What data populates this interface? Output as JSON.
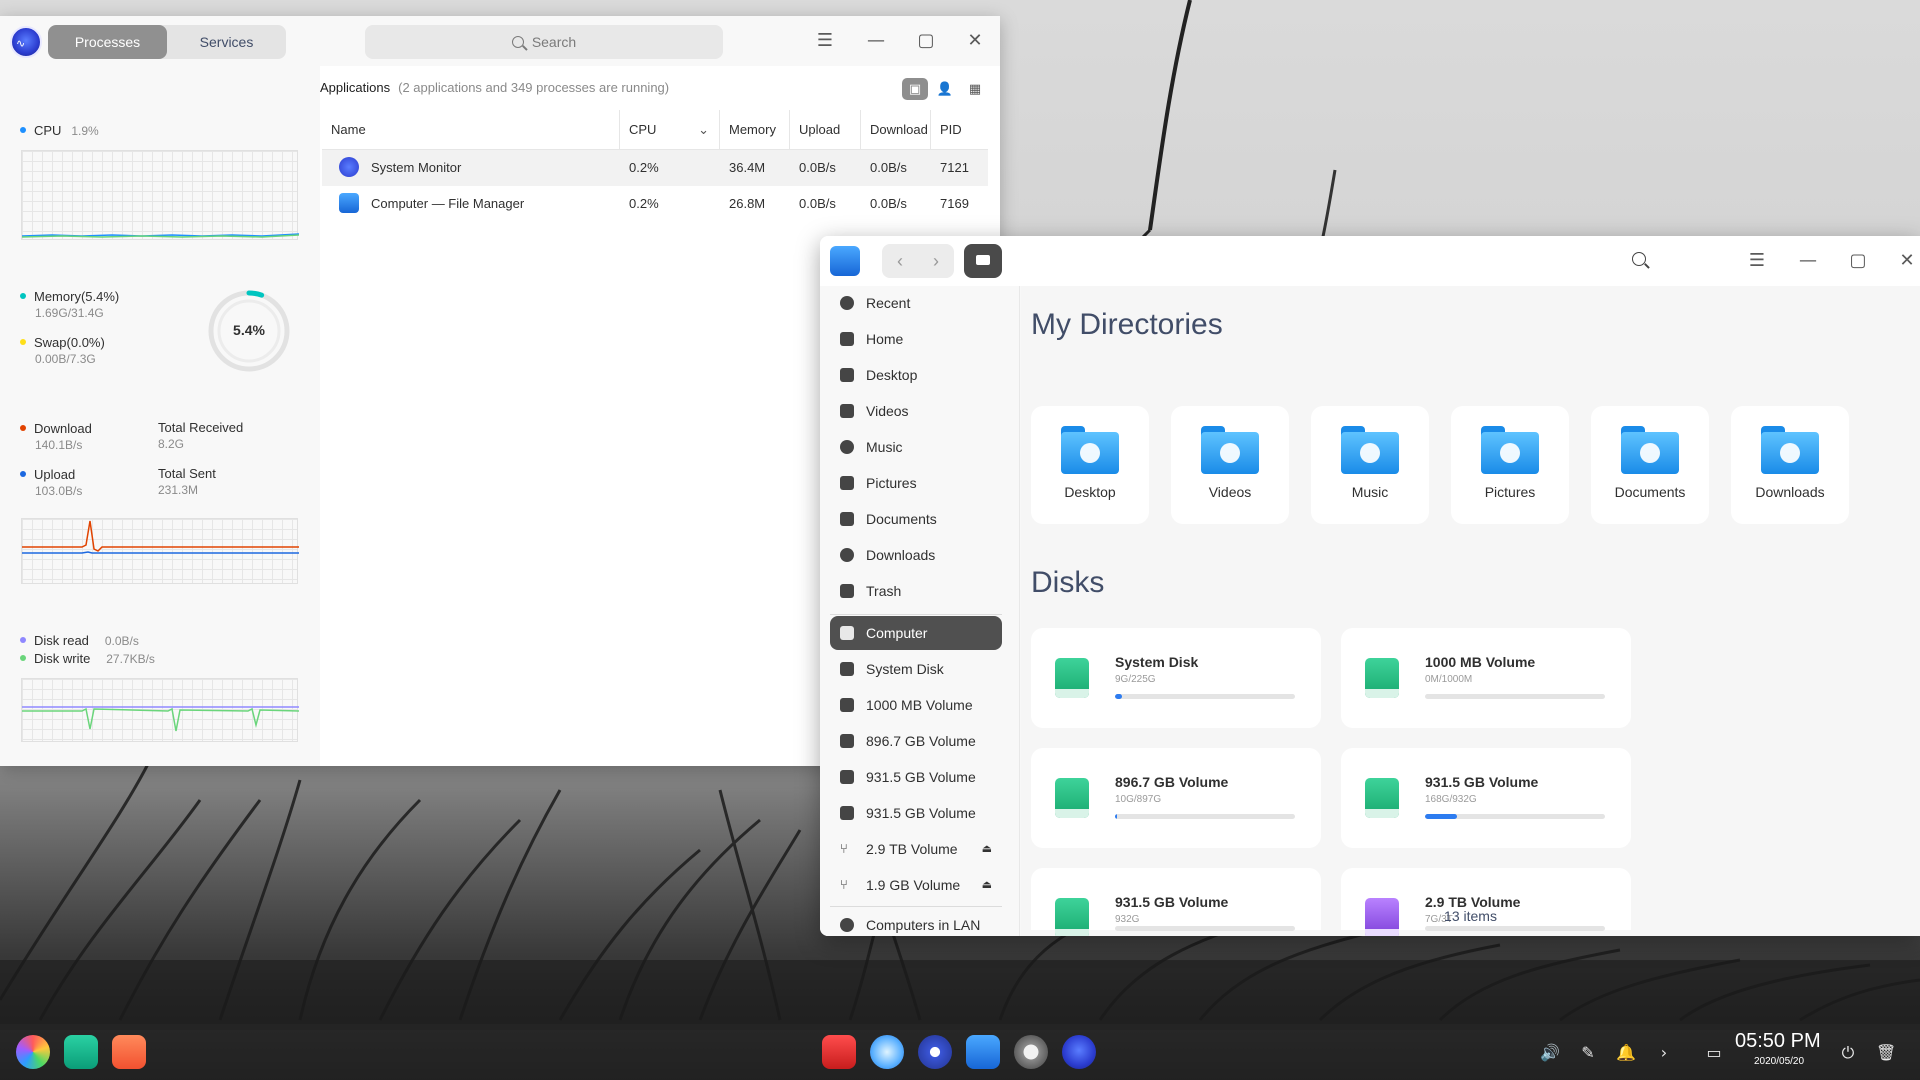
{
  "system_monitor": {
    "tabs": [
      "Processes",
      "Services"
    ],
    "search_placeholder": "Search",
    "cpu": {
      "label": "CPU",
      "value": "1.9%"
    },
    "memory": {
      "label": "Memory(5.4%)",
      "detail": "1.69G/31.4G",
      "ring_value": "5.4%",
      "fraction": 0.054
    },
    "swap": {
      "label": "Swap(0.0%)",
      "detail": "0.00B/7.3G"
    },
    "network": {
      "download_label": "Download",
      "download_value": "140.1B/s",
      "total_received_label": "Total Received",
      "total_received_value": "8.2G",
      "upload_label": "Upload",
      "upload_value": "103.0B/s",
      "total_sent_label": "Total Sent",
      "total_sent_value": "231.3M"
    },
    "disk": {
      "read_label": "Disk read",
      "read_value": "0.0B/s",
      "write_label": "Disk write",
      "write_value": "27.7KB/s"
    },
    "applications_title": "Applications",
    "applications_note": "(2 applications and 349 processes are running)",
    "columns": [
      "Name",
      "CPU",
      "Memory",
      "Upload",
      "Download",
      "PID"
    ],
    "processes": [
      {
        "name": "System Monitor",
        "cpu": "0.2%",
        "memory": "36.4M",
        "upload": "0.0B/s",
        "download": "0.0B/s",
        "pid": "7121"
      },
      {
        "name": "Computer — File Manager",
        "cpu": "0.2%",
        "memory": "26.8M",
        "upload": "0.0B/s",
        "download": "0.0B/s",
        "pid": "7169"
      }
    ],
    "colors": {
      "cpu": "#1e90ff",
      "memory": "#00c5c0",
      "swap": "#fedf19",
      "download": "#e14300",
      "upload": "#1c68e0",
      "disk_read": "#8f88ff",
      "disk_write": "#6ad57b"
    }
  },
  "file_manager": {
    "sidebar": [
      {
        "label": "Recent",
        "icon": "clock-icon"
      },
      {
        "label": "Home",
        "icon": "home-icon"
      },
      {
        "label": "Desktop",
        "icon": "desktop-icon"
      },
      {
        "label": "Videos",
        "icon": "video-icon"
      },
      {
        "label": "Music",
        "icon": "music-icon"
      },
      {
        "label": "Pictures",
        "icon": "picture-icon"
      },
      {
        "label": "Documents",
        "icon": "document-icon"
      },
      {
        "label": "Downloads",
        "icon": "download-icon"
      },
      {
        "label": "Trash",
        "icon": "trash-icon"
      },
      {
        "label": "Computer",
        "icon": "computer-icon"
      },
      {
        "label": "System Disk",
        "icon": "disk-icon"
      },
      {
        "label": "1000 MB Volume",
        "icon": "disk-icon"
      },
      {
        "label": "896.7 GB Volume",
        "icon": "disk-icon"
      },
      {
        "label": "931.5 GB Volume",
        "icon": "disk-icon"
      },
      {
        "label": "931.5 GB Volume",
        "icon": "disk-icon"
      },
      {
        "label": "2.9 TB Volume",
        "icon": "usb-icon"
      },
      {
        "label": "1.9 GB Volume",
        "icon": "usb-icon"
      },
      {
        "label": "Computers in LAN",
        "icon": "network-icon"
      }
    ],
    "my_directories_title": "My Directories",
    "directories": [
      "Desktop",
      "Videos",
      "Music",
      "Pictures",
      "Documents",
      "Downloads"
    ],
    "disks_title": "Disks",
    "disks": [
      {
        "name": "System Disk",
        "size": "9G/225G",
        "usage": 0.04
      },
      {
        "name": "1000 MB Volume",
        "size": "0M/1000M",
        "usage": 0.0
      },
      {
        "name": "896.7 GB Volume",
        "size": "10G/897G",
        "usage": 0.011
      },
      {
        "name": "931.5 GB Volume",
        "size": "168G/932G",
        "usage": 0.18
      },
      {
        "name": "931.5 GB Volume",
        "size": "932G",
        "usage": 0.0
      },
      {
        "name": "2.9 TB Volume",
        "size": "7G/3T",
        "usage": 0.0
      }
    ],
    "status": "13 items"
  },
  "dock": {
    "time": "05:50 PM",
    "date": "2020/05/20",
    "apps": [
      "launcher-icon",
      "multitask-view-icon",
      "app-store-icon",
      "terminal-icon",
      "browser-icon",
      "settings-icon",
      "file-manager-icon",
      "screenshot-icon",
      "system-monitor-icon"
    ]
  }
}
